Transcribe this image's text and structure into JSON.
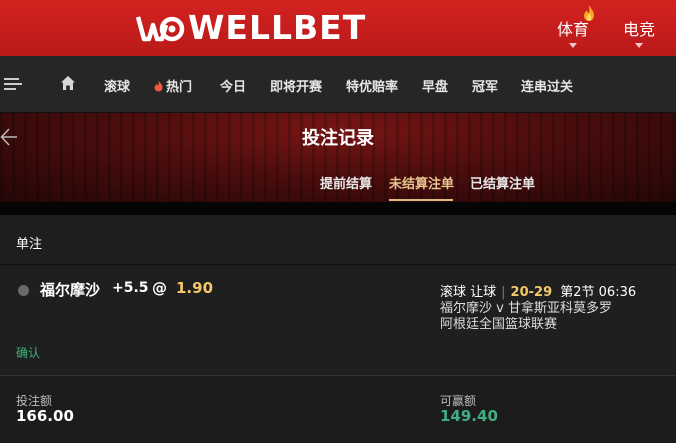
{
  "header": {
    "brand": "WELLBET",
    "tabs": [
      {
        "label": "体育",
        "icon": "flame-icon"
      },
      {
        "label": "电竞"
      }
    ]
  },
  "nav": {
    "items": [
      "滚球",
      "热门",
      "今日",
      "即将开赛",
      "特优赔率",
      "早盘",
      "冠军",
      "连串过关"
    ]
  },
  "banner": {
    "title": "投注记录",
    "subtabs": [
      "提前结算",
      "未结算注单",
      "已结算注单"
    ],
    "active_subtab": "未结算注单"
  },
  "bet": {
    "type_label": "单注",
    "selection": "福尔摩沙",
    "handicap": "+5.5",
    "at": "@",
    "odds": "1.90",
    "market": "滚球 让球",
    "score": "20-29",
    "period": "第2节 06:36",
    "match": "福尔摩沙 v 甘拿斯亚科莫多罗",
    "league": "阿根廷全国篮球联赛",
    "status": "确认",
    "stake_label": "投注额",
    "stake_value": "166.00",
    "win_label": "可赢额",
    "win_value": "149.40"
  },
  "colors": {
    "brand_red": "#c81e1d",
    "odds_yellow": "#f3c96a",
    "active_gold": "#e7c48c",
    "confirm_green": "#3fb27a",
    "win_green": "#3fae83"
  }
}
